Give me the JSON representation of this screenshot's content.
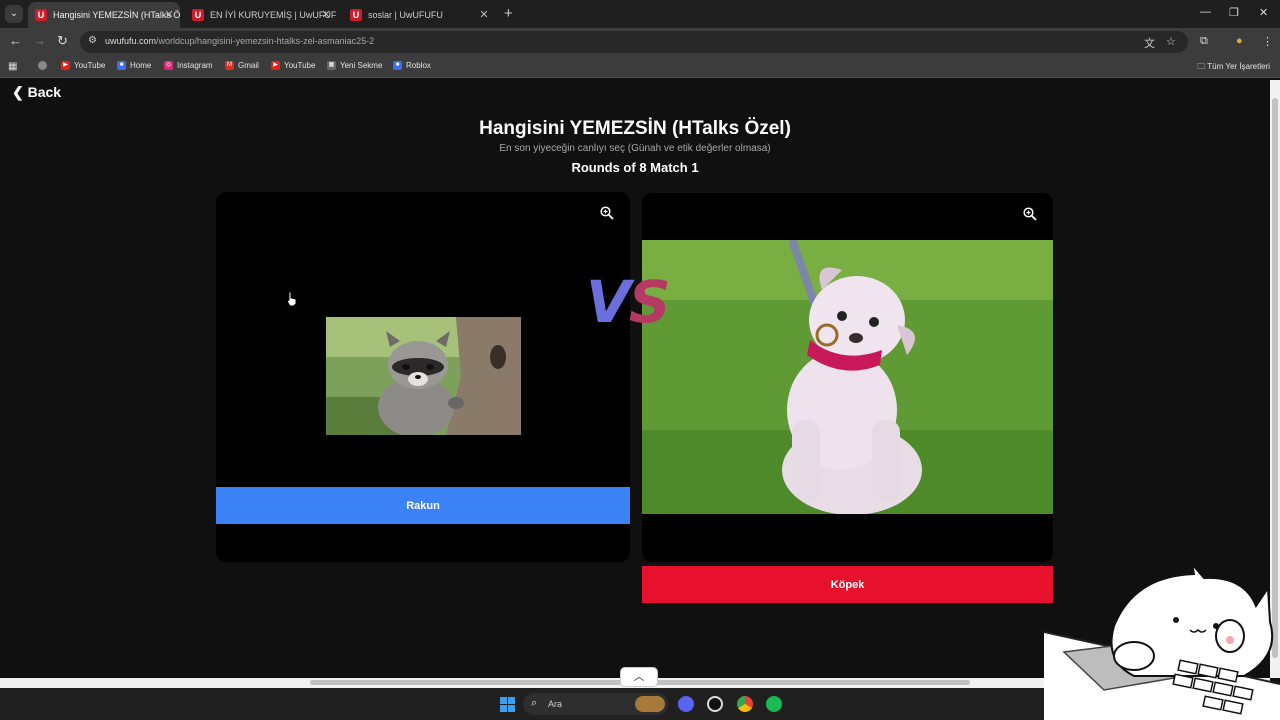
{
  "browser": {
    "tabs": [
      {
        "label": "Hangisini YEMEZSİN (HTalks Öz",
        "active": true
      },
      {
        "label": "EN İYİ KURUYEMİŞ | UwUFUFU",
        "active": false
      },
      {
        "label": "soslar | UwUFUFU",
        "active": false
      }
    ],
    "url_host": "uwufufu.com",
    "url_path": "/worldcup/hangisini-yemezsin-htalks-zel-asmaniac25-2",
    "bookmarks": [
      "YouTube",
      "Home",
      "Instagram",
      "Gmail",
      "YouTube",
      "Yeni Sekme",
      "Roblox"
    ],
    "all_bookmarks": "Tüm Yer İşaretleri"
  },
  "page": {
    "back": "Back",
    "title": "Hangisini YEMEZSİN (HTalks Özel)",
    "subtitle": "En son yiyeceğin canlıyı seç (Günah ve etik değerler olmasa)",
    "round": "Rounds of 8 Match 1",
    "vs_v": "V",
    "vs_s": "S",
    "left_choice": "Rakun",
    "right_choice": "Köpek"
  },
  "taskbar": {
    "search": "Ara"
  },
  "colors": {
    "left_button": "#3b82f6",
    "right_button": "#e8112d"
  }
}
